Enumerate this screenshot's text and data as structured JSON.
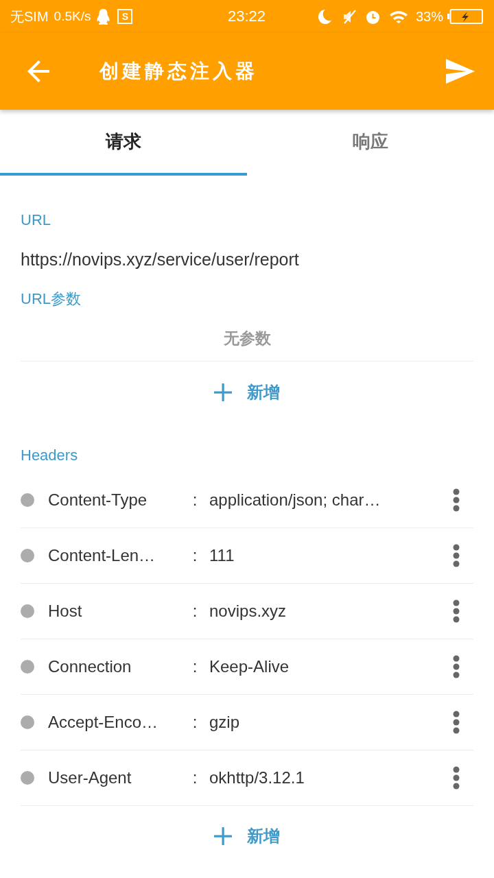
{
  "status_bar": {
    "carrier": "无SIM",
    "net_speed": "0.5K/s",
    "screenshot_glyph": "S",
    "time": "23:22",
    "battery": "33%"
  },
  "toolbar": {
    "title": "创建静态注入器"
  },
  "tabs": [
    {
      "label": "请求",
      "selected": true
    },
    {
      "label": "响应",
      "selected": false
    }
  ],
  "url_section": {
    "label": "URL",
    "value": "https://novips.xyz/service/user/report"
  },
  "params_section": {
    "label": "URL参数",
    "empty_text": "无参数",
    "add_label": "新增"
  },
  "headers_section": {
    "label": "Headers",
    "rows": [
      {
        "name": "Content-Type",
        "separator": ":",
        "value": "application/json; char…"
      },
      {
        "name": "Content-Len…",
        "separator": ":",
        "value": "111"
      },
      {
        "name": "Host",
        "separator": ":",
        "value": "novips.xyz"
      },
      {
        "name": "Connection",
        "separator": ":",
        "value": "Keep-Alive"
      },
      {
        "name": "Accept-Enco…",
        "separator": ":",
        "value": "gzip"
      },
      {
        "name": "User-Agent",
        "separator": ":",
        "value": "okhttp/3.12.1"
      }
    ],
    "add_label": "新增"
  }
}
